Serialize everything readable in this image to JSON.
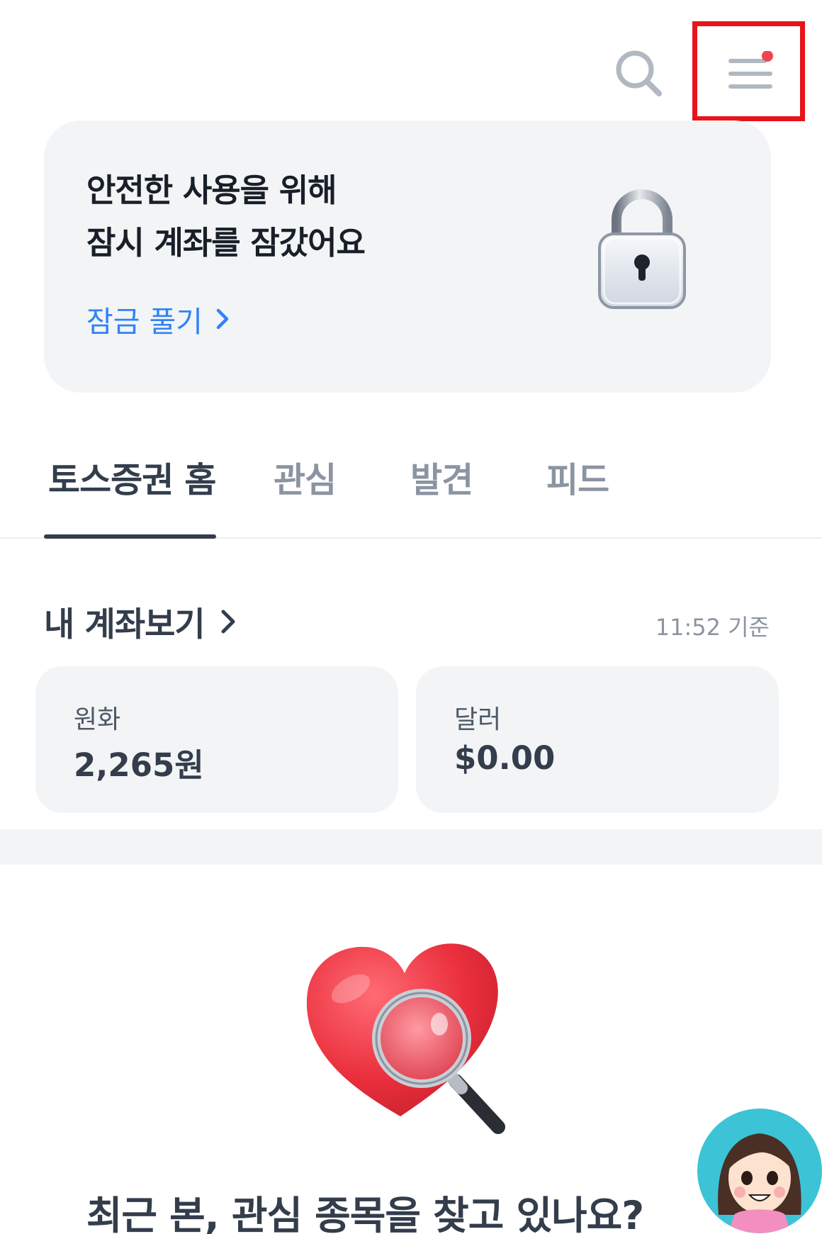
{
  "header": {
    "search_icon": "search-icon",
    "menu_icon": "hamburger-menu-icon",
    "menu_badge_color": "#f04452"
  },
  "lock_banner": {
    "title": "안전한 사용을 위해\n잠시 계좌를 잠갔어요",
    "unlock_label": "잠금 풀기",
    "icon": "padlock-icon",
    "accent_color": "#3182f6"
  },
  "tabs": [
    {
      "label": "토스증권 홈",
      "active": true
    },
    {
      "label": "관심",
      "active": false
    },
    {
      "label": "발견",
      "active": false
    },
    {
      "label": "피드",
      "active": false
    }
  ],
  "accounts": {
    "header_label": "내 계좌보기",
    "timestamp": "11:52 기준",
    "cards": [
      {
        "label": "원화",
        "value": "2,265원"
      },
      {
        "label": "달러",
        "value": "$0.00"
      }
    ]
  },
  "promo": {
    "text": "최근 본, 관심 종목을 찾고 있나요?",
    "icon": "heart-magnifier-icon"
  },
  "avatar": {
    "icon": "character-avatar-icon"
  }
}
